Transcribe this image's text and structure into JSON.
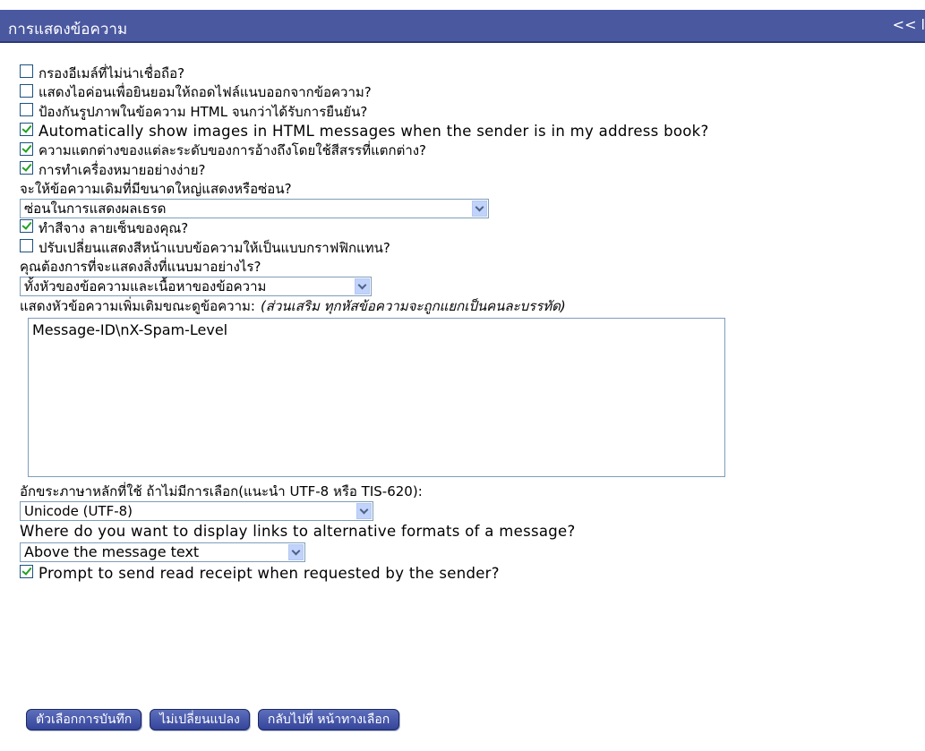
{
  "header": {
    "title": "การแสดงข้อความ",
    "nav": "<< l"
  },
  "options": [
    {
      "label": "กรองอีเมล์ที่ไม่น่าเชื่อถือ?",
      "checked": false
    },
    {
      "label": "แสดงไอค่อนเพื่อยินยอมให้ถอดไฟล์แนบออกจากข้อความ?",
      "checked": false
    },
    {
      "label": "ป้องกันรูปภาพในข้อความ HTML จนกว่าได้รับการยืนยัน?",
      "checked": false
    },
    {
      "label": "Automatically show images in HTML messages when the sender is in my address book?",
      "checked": true
    },
    {
      "label": "ความแตกต่างของแต่ละระดับของการอ้างถึงโดยใช้สีสรรที่แตกต่าง?",
      "checked": true
    },
    {
      "label": "การทำเครื่องหมายอย่างง่าย?",
      "checked": true
    }
  ],
  "large_msg": {
    "label": "จะให้ข้อความเดิมที่มีขนาดใหญ่แสดงหรือซ่อน?",
    "value": "ซ่อนในการแสดงผลเธรด"
  },
  "options2": [
    {
      "label": "ทำสีจาง ลายเซ็นของคุณ?",
      "checked": true
    },
    {
      "label": "ปรับเปลี่ยนแสดงสีหน้าแบบข้อความให้เป็นแบบกราฟฟิกแทน?",
      "checked": false
    }
  ],
  "attachments": {
    "label": "คุณต้องการที่จะแสดงสิ่งที่แนบมาอย่างไร?",
    "value": "ทั้งหัวของข้อความและเนื้อหาของข้อความ"
  },
  "headers_field": {
    "label": "แสดงหัวข้อความเพิ่มเติมขณะดูข้อความ:",
    "note": "(ส่วนเสริม ทุกหัสข้อความจะถูกแยกเป็นคนละบรรทัด)",
    "value": "Message-ID\\nX-Spam-Level"
  },
  "charset": {
    "label": "อักขระภาษาหลักที่ใช้ ถ้าไม่มีการเลือก(แนะนำ UTF-8 หรือ TIS-620):",
    "value": "Unicode (UTF-8)"
  },
  "alt_links": {
    "label": "Where do you want to display links to alternative formats of a message?",
    "value": "Above the message text"
  },
  "read_receipt": {
    "label": "Prompt to send read receipt when requested by the sender?",
    "checked": true
  },
  "buttons": {
    "save": "ตัวเลือกการบันทึก",
    "cancel": "ไม่เปลี่ยนแปลง",
    "back": "กลับไปที่ หน้าทางเลือก"
  },
  "colors": {
    "header_bg": "#4a58a0",
    "button_bg": "#3f4fa6",
    "check_green": "#21a121"
  }
}
